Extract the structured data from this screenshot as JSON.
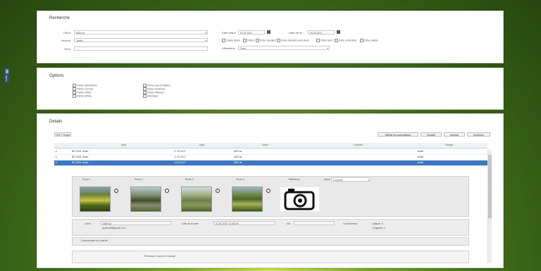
{
  "sidebar_tab": {
    "label": "MENU"
  },
  "search": {
    "title": "Recherche",
    "fields": [
      {
        "label": "Client",
        "value": "ABS sa"
      },
      {
        "label": "Version",
        "value": "Jardin"
      },
      {
        "label": "Nom",
        "value": ""
      }
    ],
    "date_from": {
      "label": "Date début",
      "value": "01.01.2017"
    },
    "date_to": {
      "label": "Date de fin",
      "value": "28.03.2017"
    },
    "checks": [
      "Toutes fiches",
      "Fiches",
      "Fiche standard",
      "Fiche standard avec photo",
      "Fiche client",
      "Fiche vérification",
      "Fiche validée"
    ],
    "status": {
      "label": "Affectation",
      "value": "Tous"
    }
  },
  "options": {
    "title": "Options",
    "col1": [
      "Fiches identifiantes",
      "Fiches non lues",
      "Fiches mixtes",
      "Fiches lisibles"
    ],
    "col2": [
      "Fiches lues et traitées",
      "Fiches archivées",
      "Fiches effacées",
      "Historique"
    ]
  },
  "details": {
    "title": "Details",
    "left_buttons": [
      "PDF",
      "Excel"
    ],
    "right_buttons": [
      "Afficher les commentaires",
      "Exporter",
      "Imprimer",
      "Supprimer"
    ],
    "columns": [
      "Nom",
      "Date",
      "Client",
      "Contrôle",
      "Version"
    ],
    "rows": [
      {
        "name": "BR 1006 Jardin",
        "date": "27.01.2017",
        "client": "ABS sa",
        "control": "",
        "version": "Jardin"
      },
      {
        "name": "BR 1008 Jardin",
        "date": "27.01.2017",
        "client": "ABS sa",
        "control": "",
        "version": "Jardin"
      },
      {
        "name": "BR 1009 Jardin",
        "date": "14.02.2017",
        "client": "ABS sa",
        "control": "",
        "version": "Jardin"
      }
    ],
    "photo_labels": [
      "Photo 1",
      "Photo 2",
      "Photo 3",
      "Photo 4",
      "Référence",
      "Statut"
    ],
    "status_select": "Contrôlé",
    "info": {
      "client_label": "Client",
      "client_value": "ABS sa",
      "email_value": "jardin.jeff@gmail.com",
      "date_label": "Date de la visite",
      "date_value": "27.01.2017 12:35:10",
      "user_label": "Nbr",
      "coord_label": "Coordonnées",
      "lat": "Latitude: 0",
      "lng": "Longitude: 0"
    },
    "comment_label": "Commentaire du contrôle",
    "footer_text": "Remarque: aucune remarque"
  }
}
